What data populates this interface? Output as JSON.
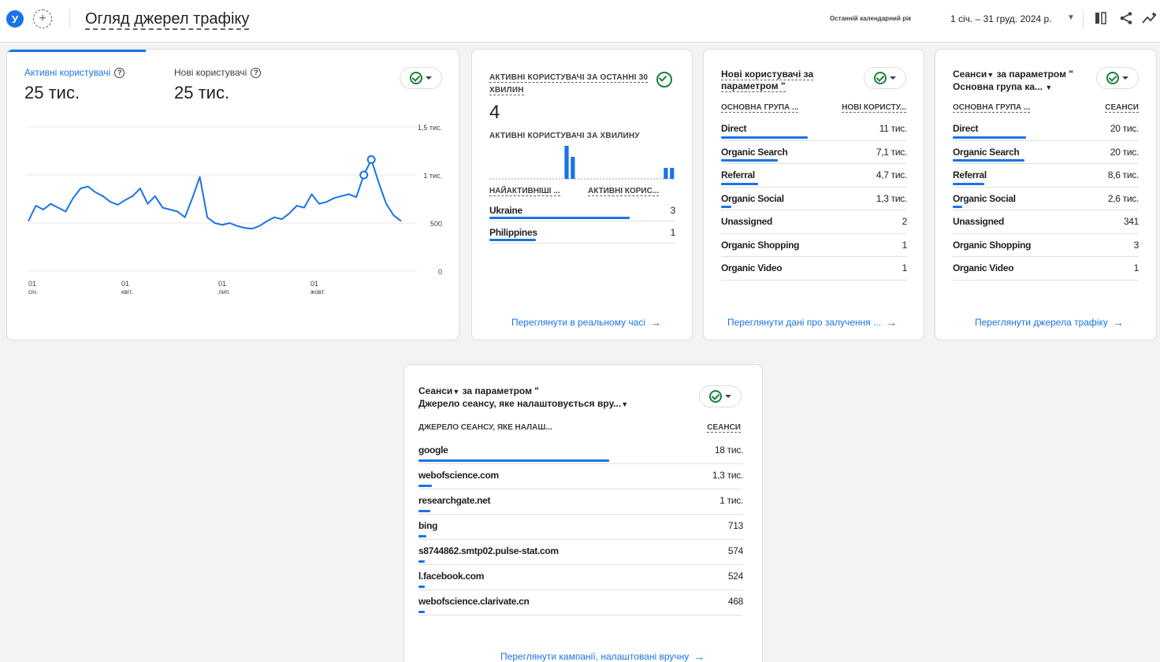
{
  "header": {
    "avatar_letter": "У",
    "add_icon": "+",
    "title": "Огляд джерел трафіку",
    "date_label": "Останній календарний рік",
    "date_range": "1 січ. – 31 груд. 2024 р.",
    "icons": [
      "compare-icon",
      "share-icon",
      "insights-icon"
    ]
  },
  "overview": {
    "metric1_label": "Активні користувачі",
    "metric1_value": "25 тис.",
    "metric2_label": "Нові користувачі",
    "metric2_value": "25 тис.",
    "chart_data": {
      "type": "line",
      "y_ticks": [
        "1,5 тис.",
        "1 тис.",
        "500",
        "0"
      ],
      "ylim": [
        0,
        1500
      ],
      "x_ticks": [
        {
          "day": "01",
          "month": "січ."
        },
        {
          "day": "01",
          "month": "квіт."
        },
        {
          "day": "01",
          "month": "лип."
        },
        {
          "day": "01",
          "month": "жовт."
        }
      ],
      "grid": true,
      "series": [
        {
          "values": [
            520,
            680,
            640,
            700,
            660,
            620,
            760,
            860,
            880,
            820,
            780,
            720,
            690,
            740,
            780,
            860,
            700,
            780,
            660,
            640,
            620,
            560,
            760,
            980,
            560,
            500,
            480,
            500,
            470,
            450,
            440,
            470,
            520,
            560,
            540,
            600,
            680,
            660,
            800,
            700,
            720,
            760,
            780,
            800,
            770,
            1000,
            1160,
            920,
            700,
            580,
            520
          ]
        }
      ]
    }
  },
  "realtime": {
    "title": "АКТИВНІ КОРИСТУВАЧІ ЗА ОСТАННІ 30 ХВИЛИН",
    "value": "4",
    "subtitle": "АКТИВНІ КОРИСТУВАЧІ ЗА ХВИЛИНУ",
    "bars": [
      0,
      0,
      0,
      0,
      0,
      0,
      0,
      0,
      0,
      0,
      0,
      0,
      3,
      2,
      0,
      0,
      0,
      0,
      0,
      0,
      0,
      0,
      0,
      0,
      0,
      0,
      0,
      0,
      1,
      1
    ],
    "col1": "НАЙАКТИВНІШІ ...",
    "col2": "АКТИВНІ КОРИС...",
    "rows": [
      {
        "label": "Ukraine",
        "value": "3",
        "bar": 1.0
      },
      {
        "label": "Philippines",
        "value": "1",
        "bar": 0.33
      }
    ],
    "link": "Переглянути в реальному часі"
  },
  "new_users": {
    "title": "Нові користувачі за параметром \"",
    "col1": "ОСНОВНА ГРУПА ...",
    "col2": "НОВІ КОРИСТУ...",
    "rows": [
      {
        "label": "Direct",
        "value": "11 тис.",
        "bar": 1.0
      },
      {
        "label": "Organic Search",
        "value": "7,1 тис.",
        "bar": 0.65
      },
      {
        "label": "Referral",
        "value": "4,7 тис.",
        "bar": 0.43
      },
      {
        "label": "Organic Social",
        "value": "1,3 тис.",
        "bar": 0.12
      },
      {
        "label": "Unassigned",
        "value": "2",
        "bar": 0
      },
      {
        "label": "Organic Shopping",
        "value": "1",
        "bar": 0
      },
      {
        "label": "Organic Video",
        "value": "1",
        "bar": 0
      }
    ],
    "link": "Переглянути дані про залучення ..."
  },
  "sessions_group": {
    "title_line1": "Сеанси",
    "title_line1_rest": " за параметром \"",
    "title_line2": "Основна група ка...",
    "col1": "ОСНОВНА ГРУПА ...",
    "col2": "СЕАНСИ",
    "rows": [
      {
        "label": "Direct",
        "value": "20 тис.",
        "bar": 1.0
      },
      {
        "label": "Organic Search",
        "value": "20 тис.",
        "bar": 0.98
      },
      {
        "label": "Referral",
        "value": "8,6 тис.",
        "bar": 0.43
      },
      {
        "label": "Organic Social",
        "value": "2,6 тис.",
        "bar": 0.13
      },
      {
        "label": "Unassigned",
        "value": "341",
        "bar": 0
      },
      {
        "label": "Organic Shopping",
        "value": "3",
        "bar": 0
      },
      {
        "label": "Organic Video",
        "value": "1",
        "bar": 0
      }
    ],
    "link": "Переглянути джерела трафіку"
  },
  "sessions_source": {
    "title_line1": "Сеанси",
    "title_line1_rest": " за параметром \"",
    "title_line2": "Джерело сеансу, яке налаштовується вру...",
    "col1": "ДЖЕРЕЛО СЕАНСУ, ЯКЕ НАЛАШ...",
    "col2": "СЕАНСИ",
    "rows": [
      {
        "label": "google",
        "value": "18 тис.",
        "bar": 1.0
      },
      {
        "label": "webofscience.com",
        "value": "1,3 тис.",
        "bar": 0.07
      },
      {
        "label": "researchgate.net",
        "value": "1 тис.",
        "bar": 0.06
      },
      {
        "label": "bing",
        "value": "713",
        "bar": 0.04
      },
      {
        "label": "s8744862.smtp02.pulse-stat.com",
        "value": "574",
        "bar": 0.03
      },
      {
        "label": "l.facebook.com",
        "value": "524",
        "bar": 0.03
      },
      {
        "label": "webofscience.clarivate.cn",
        "value": "468",
        "bar": 0.03
      }
    ],
    "link": "Переглянути кампанії, налаштовані вручну"
  },
  "colors": {
    "accent": "#1a73e8",
    "check": "#188038"
  }
}
